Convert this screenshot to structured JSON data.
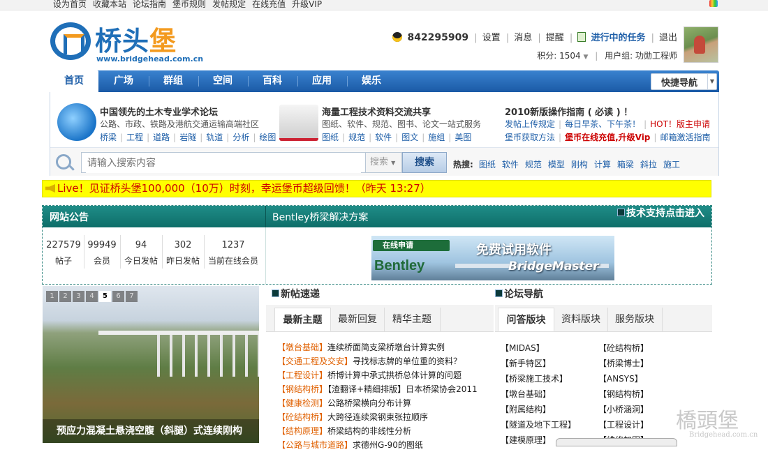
{
  "topbar": {
    "links": [
      "设为首页",
      "收藏本站",
      "论坛指南",
      "堡币规则",
      "发帖规定",
      "在线充值",
      "升级VIP"
    ]
  },
  "logo": {
    "name_blue": "桥头",
    "name_orange": "堡",
    "url": "www.bridgehead.com.cn"
  },
  "user": {
    "qq": "842295909",
    "settings": "设置",
    "messages": "消息",
    "reminders": "提醒",
    "tasks": "进行中的任务",
    "logout": "退出",
    "points": "积分: 1504",
    "group": "用户组: 功勋工程师"
  },
  "nav": {
    "items": [
      "首页",
      "广场",
      "群组",
      "空间",
      "百科",
      "应用",
      "娱乐"
    ],
    "quick": "快捷导航"
  },
  "info": {
    "block1": {
      "title": "中国领先的土木专业学术论坛",
      "desc": "公路、市政、铁路及港航交通运输高端社区",
      "links": [
        "桥梁",
        "工程",
        "道路",
        "岩隧",
        "轨道",
        "分析",
        "绘图"
      ]
    },
    "block2": {
      "title": "海量工程技术资料交流共享",
      "desc": "图纸、软件、规范、图书、论文一站式服务",
      "links": [
        "图纸",
        "规范",
        "软件",
        "图文",
        "施组",
        "美图"
      ]
    },
    "block3": {
      "title": "2010新版操作指南 ( 必读 ) ！",
      "line1": [
        "发帖上传规定",
        "每日早茶、下午茶！",
        "HOT！",
        "版主申请"
      ],
      "line2": [
        "堡币获取方法",
        "堡币在线充值,升级Vip",
        "邮箱激活指南"
      ]
    }
  },
  "search": {
    "placeholder": "请输入搜索内容",
    "select": "搜索",
    "button": "搜索",
    "hot_label": "热搜:",
    "hot": [
      "图纸",
      "软件",
      "规范",
      "模型",
      "刚构",
      "计算",
      "箱梁",
      "斜拉",
      "施工"
    ]
  },
  "ticker": "Live！见证桥头堡100,000（10万）时刻，幸运堡币超级回馈！（昨天 13:27）",
  "notice": {
    "title": "网站公告",
    "bentley_title": "Bentley桥梁解决方案",
    "support": "技术支持点击进入",
    "stats": [
      {
        "value": "227579",
        "label": "帖子"
      },
      {
        "value": "99949",
        "label": "会员"
      },
      {
        "value": "94",
        "label": "今日发帖"
      },
      {
        "value": "302",
        "label": "昨日发帖"
      },
      {
        "value": "1237",
        "label": "当前在线会员"
      }
    ]
  },
  "banner": {
    "apply": "在线申请",
    "brand": "Bentley",
    "free": "免费试用软件",
    "product": "BridgeMaster"
  },
  "photo": {
    "pages": [
      "1",
      "2",
      "3",
      "4",
      "5",
      "6",
      "7"
    ],
    "active_page": "5",
    "caption": "预应力混凝土悬浇空腹（斜腿）式连续刚构"
  },
  "newposts": {
    "title": "新帖速递",
    "tabs": [
      "最新主题",
      "最新回复",
      "精华主题"
    ],
    "items": [
      {
        "cat": "【墩台基础】",
        "title": "连续桥面简支梁桥墩台计算实例"
      },
      {
        "cat": "【交通工程及交安】",
        "title": "寻找标志牌的单位重的资料？"
      },
      {
        "cat": "【工程设计】",
        "title": "桥博计算中承式拱桥总体计算的问题"
      },
      {
        "cat": "【钢结构桥】",
        "title": "【渣翻译+精细排版】日本桥梁协会2011"
      },
      {
        "cat": "【健康检测】",
        "title": "公路桥梁横向分布计算"
      },
      {
        "cat": "【砼结构桥】",
        "title": "大跨径连续梁钢束张拉顺序"
      },
      {
        "cat": "【结构原理】",
        "title": "桥梁结构的非线性分析"
      },
      {
        "cat": "【公路与城市道路】",
        "title": "求德州G-90的图纸"
      }
    ]
  },
  "forumnav": {
    "title": "论坛导航",
    "tabs": [
      "问答版块",
      "资料版块",
      "服务版块"
    ],
    "col1": [
      "【MIDAS】",
      "【新手特区】",
      "【桥梁施工技术】",
      "【墩台基础】",
      "【附属结构】",
      "【隧道及地下工程】",
      "【建模原理】"
    ],
    "col2": [
      "【砼结构桥】",
      "【桥梁博士】",
      "【ANSYS】",
      "【钢结构桥】",
      "【小桥涵洞】",
      "【工程设计】",
      "【维修加固】"
    ]
  },
  "watermark": {
    "text": "橋頭堡",
    "url": "Bridgehead.com.cn"
  },
  "colors": {
    "nav_blue": "#1f62b0",
    "teal": "#0e6e69",
    "ticker_yellow": "#ffff00",
    "category_orange": "#e06000"
  }
}
